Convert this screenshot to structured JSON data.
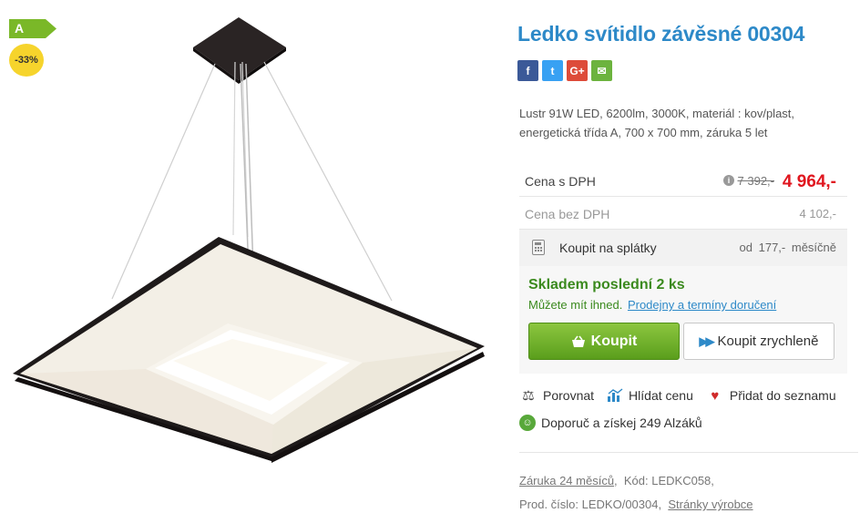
{
  "badges": {
    "energy_class": "A",
    "discount": "-33%",
    "energy_color": "#7ab828",
    "discount_color": "#f6d42c"
  },
  "product": {
    "title": "Ledko svítidlo závěsné 00304",
    "description": "Lustr 91W LED, 6200lm, 3000K, materiál : kov/plast, energetická třída A, 700 x 700 mm, záruka 5 let"
  },
  "share": [
    {
      "name": "facebook-icon",
      "glyph": "f"
    },
    {
      "name": "twitter-icon",
      "glyph": "t"
    },
    {
      "name": "google-plus-icon",
      "glyph": "G+"
    },
    {
      "name": "email-icon",
      "glyph": "✉"
    }
  ],
  "price": {
    "with_vat_label": "Cena s DPH",
    "info_glyph": "i",
    "old_price": "7 392,-",
    "new_price": "4 964,-",
    "without_vat_label": "Cena bez DPH",
    "without_vat_value": "4 102,-",
    "installment_label": "Koupit na splátky",
    "installment_value": "od  177,-  měsíčně"
  },
  "stock": {
    "status": "Skladem poslední 2 ks",
    "available_text": "Můžete mít ihned.",
    "stores_link": "Prodejny a termíny doručení"
  },
  "buttons": {
    "buy_label": "Koupit",
    "quick_buy_label": "Koupit zrychleně"
  },
  "actions": {
    "compare": "Porovnat",
    "watch_price": "Hlídat cenu",
    "add_to_list": "Přidat do seznamu",
    "recommend": "Doporuč a získej 249 Alzáků"
  },
  "meta": {
    "warranty_link": "Záruka 24 měsíců",
    "code_label": "Kód: LEDKC058,",
    "product_number": "Prod. číslo: LEDKO/00304,",
    "manufacturer_link": "Stránky výrobce"
  },
  "colors": {
    "title_blue": "#2d89c8",
    "price_red": "#e0161f",
    "stock_green": "#3b8a1e",
    "buy_green": "#6cb32a"
  }
}
